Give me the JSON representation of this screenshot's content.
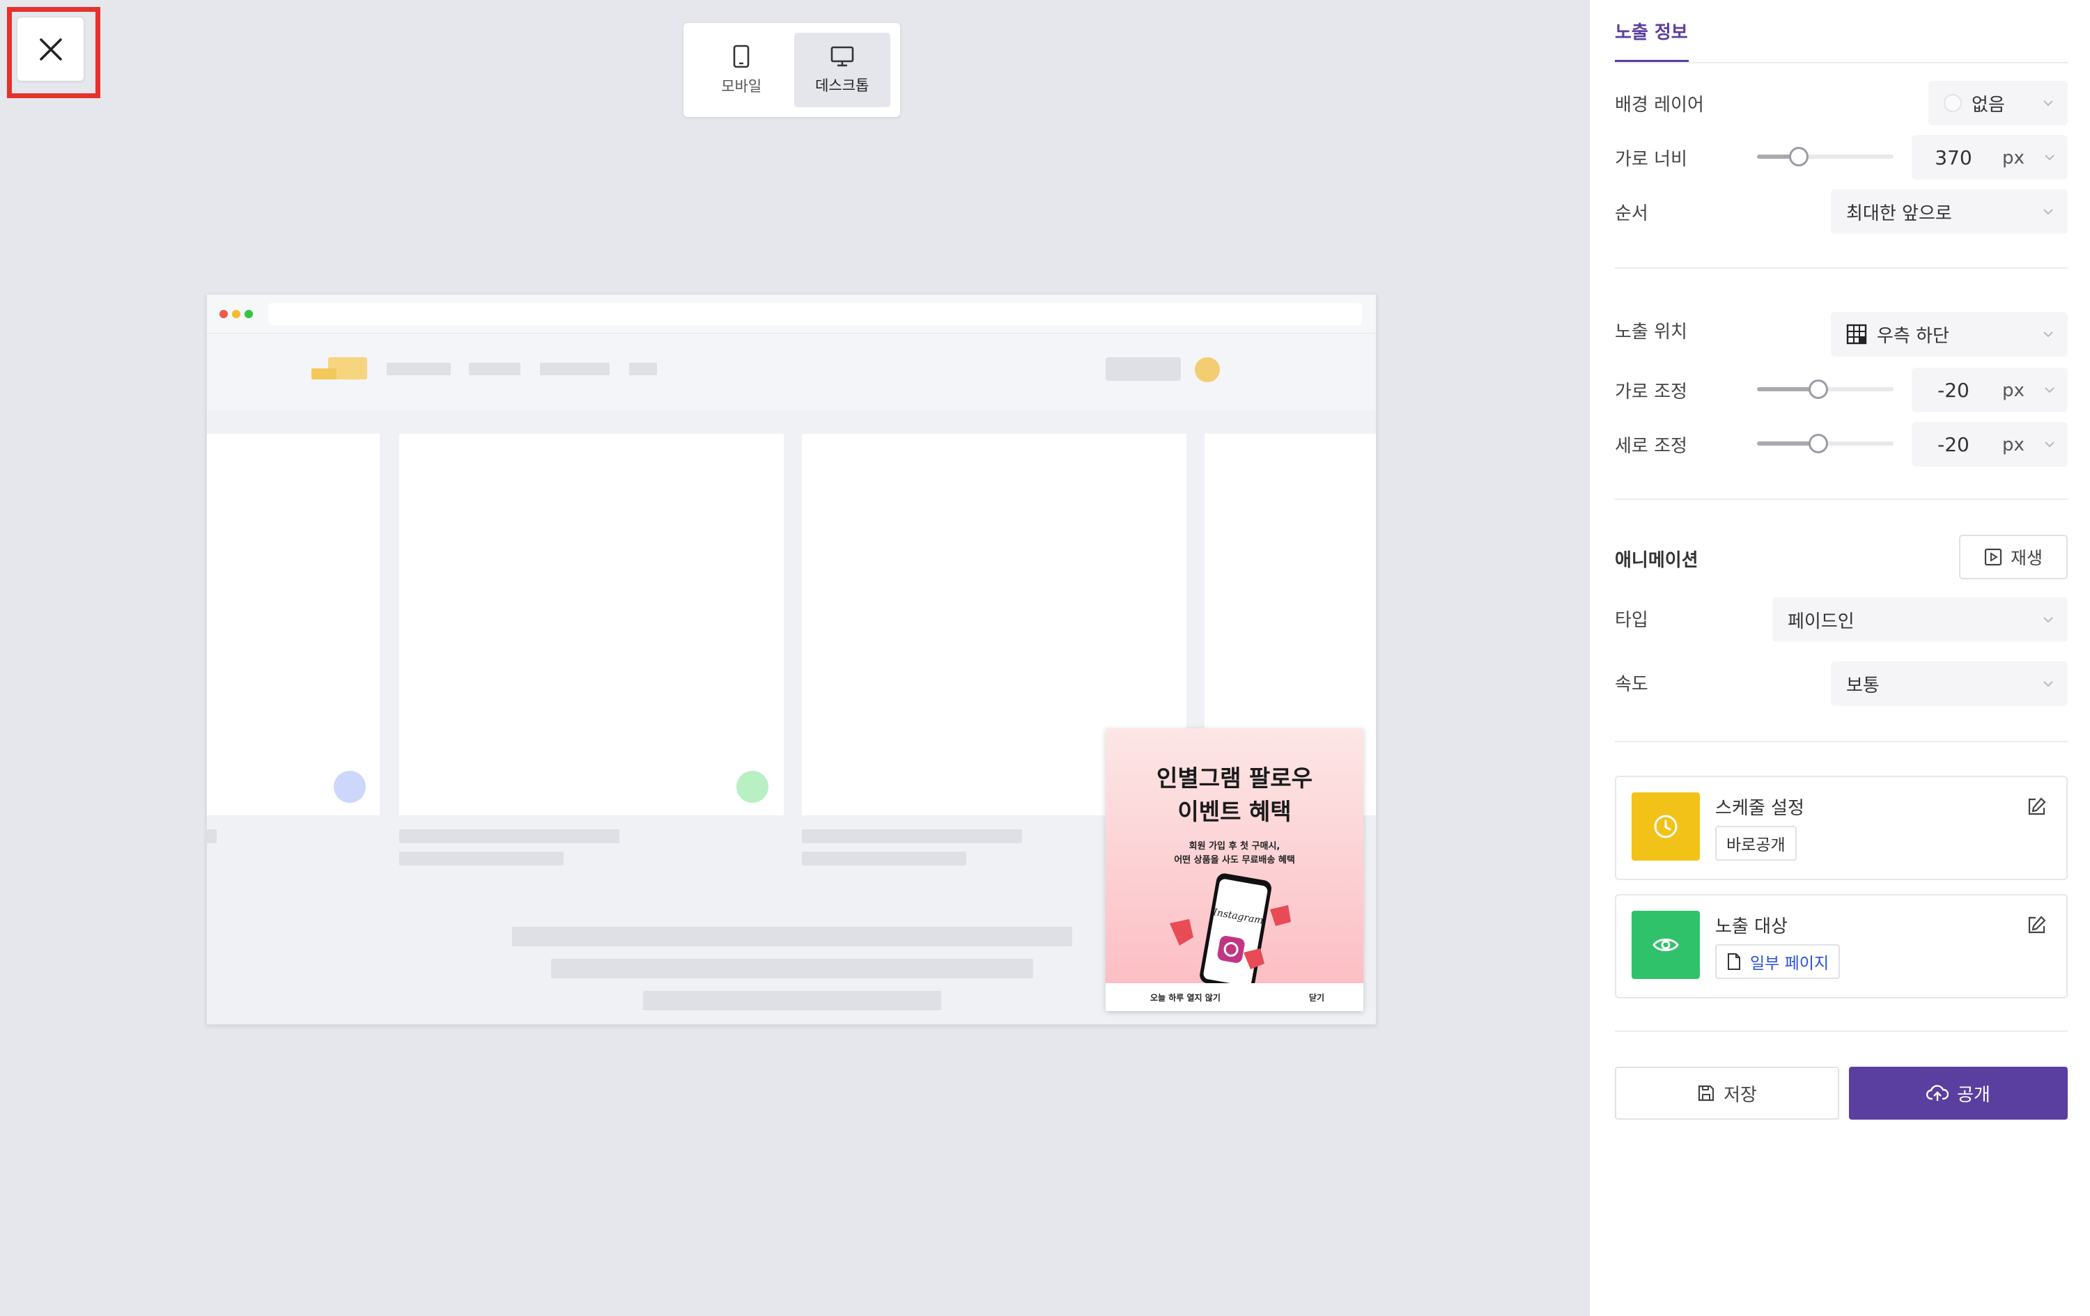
{
  "device_toggle": {
    "mobile_label": "모바일",
    "desktop_label": "데스크톱"
  },
  "popup": {
    "title": "인별그램 팔로우\n이벤트 혜택",
    "subtitle": "회원 가입 후 첫 구매시,\n어떤 상품을 사도 무료배송 혜택",
    "phone_brand": "Instagram",
    "footer_left": "오늘 하루 열지 않기",
    "footer_right": "닫기"
  },
  "panel": {
    "tab_label": "노출 정보",
    "bg_layer": {
      "label": "배경 레이어",
      "value": "없음"
    },
    "width": {
      "label": "가로 너비",
      "value": "370",
      "unit": "px",
      "slider_fraction": 0.3
    },
    "order": {
      "label": "순서",
      "value": "최대한 앞으로"
    },
    "position": {
      "label": "노출 위치",
      "value": "우측 하단"
    },
    "offset_x": {
      "label": "가로 조정",
      "value": "-20",
      "unit": "px",
      "slider_fraction": 0.45
    },
    "offset_y": {
      "label": "세로 조정",
      "value": "-20",
      "unit": "px",
      "slider_fraction": 0.45
    },
    "animation": {
      "label": "애니메이션",
      "play_label": "재생"
    },
    "anim_type": {
      "label": "타입",
      "value": "페이드인"
    },
    "anim_speed": {
      "label": "속도",
      "value": "보통"
    },
    "schedule": {
      "title": "스케줄 설정",
      "chip": "바로공개"
    },
    "target": {
      "title": "노출 대상",
      "chip": "일부 페이지"
    },
    "save_label": "저장",
    "publish_label": "공개"
  },
  "colors": {
    "accent": "#5b3fa0",
    "schedule_icon": "#f2c218",
    "target_icon": "#2fc26b",
    "link_blue": "#2a4fd6",
    "close_highlight": "#e5322d"
  }
}
